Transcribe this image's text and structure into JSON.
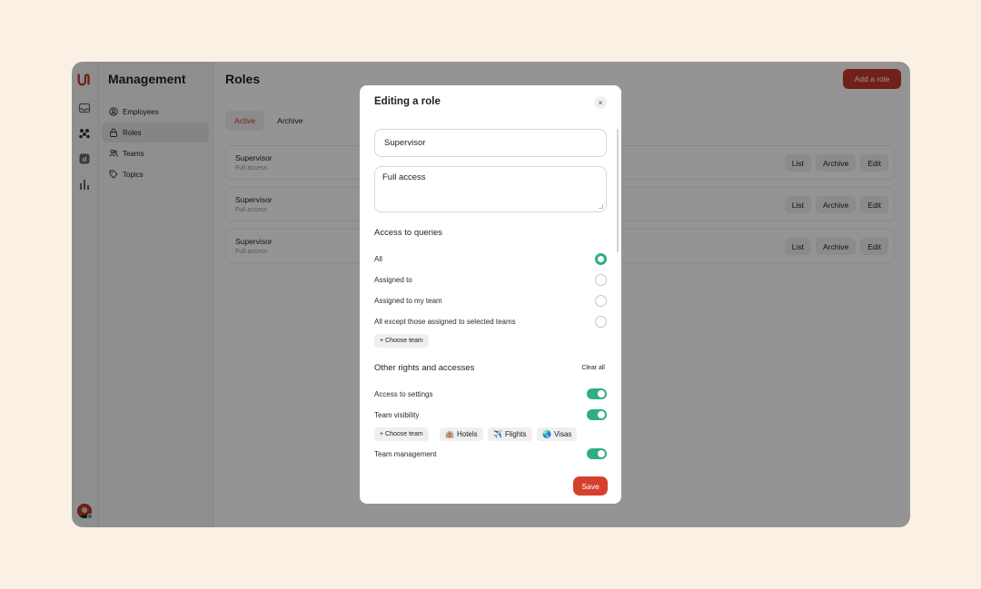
{
  "sidebar": {
    "title": "Management",
    "items": [
      {
        "label": "Employees"
      },
      {
        "label": "Roles"
      },
      {
        "label": "Teams"
      },
      {
        "label": "Topics"
      }
    ]
  },
  "main": {
    "title": "Roles",
    "add_label": "Add a role",
    "tabs": [
      {
        "label": "Active"
      },
      {
        "label": "Archive"
      }
    ],
    "rows": [
      {
        "name": "Supervisor",
        "sub": "Full access"
      },
      {
        "name": "Supervisor",
        "sub": "Full access"
      },
      {
        "name": "Supervisor",
        "sub": "Full access"
      }
    ],
    "row_actions": {
      "list": "List",
      "archive": "Archive",
      "edit": "Edit"
    }
  },
  "modal": {
    "title": "Editing a role",
    "close_symbol": "×",
    "name_value": "Supervisor",
    "description_value": "Full access",
    "queries_title": "Access to queries",
    "queries": [
      {
        "label": "All",
        "selected": true
      },
      {
        "label": "Assigned to",
        "selected": false
      },
      {
        "label": "Assigned to my team",
        "selected": false
      },
      {
        "label": "All except those assigned to selected teams",
        "selected": false
      }
    ],
    "choose_team_label": "+ Choose team",
    "other_title": "Other rights and accesses",
    "clear_all": "Clear all",
    "rights": [
      {
        "label": "Access to settings",
        "enabled": true
      },
      {
        "label": "Team visibility",
        "enabled": true
      },
      {
        "label": "Team management",
        "enabled": true
      }
    ],
    "teams": [
      {
        "icon": "🏨",
        "name": "Hotels"
      },
      {
        "icon": "✈️",
        "name": "Flights"
      },
      {
        "icon": "🌏",
        "name": "Visas"
      }
    ],
    "save_label": "Save"
  },
  "colors": {
    "accent": "#c53a2a",
    "toggle_on": "#2fae80",
    "page_bg": "#fbf0e4"
  }
}
